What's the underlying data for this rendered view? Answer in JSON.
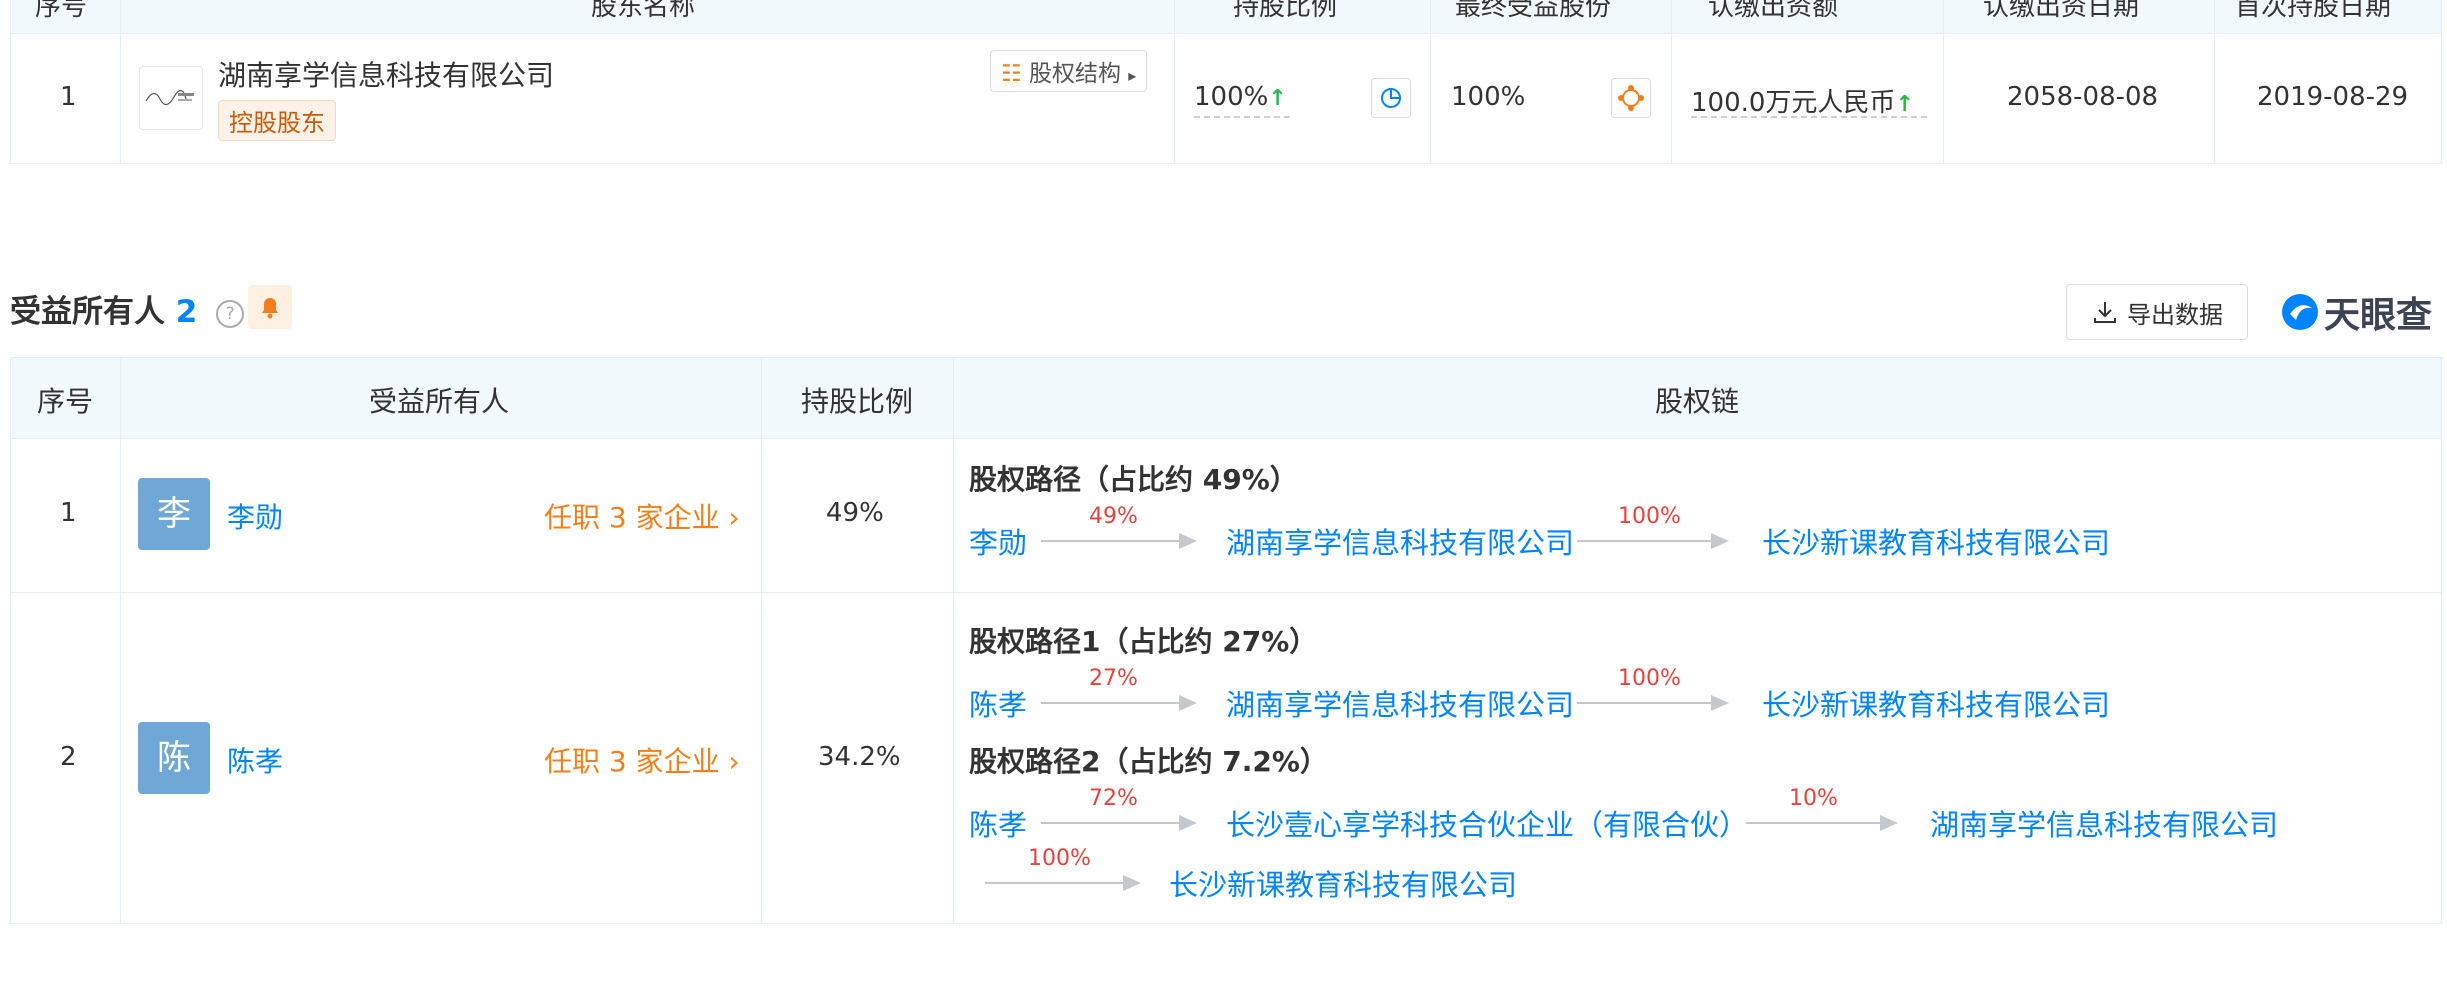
{
  "shareholder_table": {
    "headers": {
      "seq": "序号",
      "name": "股东名称",
      "ratio": "持股比例",
      "final_benefit": "最终受益股份",
      "capital": "认缴出资额",
      "capital_date": "认缴出资日期",
      "first_date": "首次持股日期"
    },
    "row": {
      "seq": "1",
      "company": "湖南享学信息科技有限公司",
      "badge": "控股股东",
      "structure_btn": "股权结构",
      "ratio": "100%",
      "final_benefit": "100%",
      "capital": "100.0万元人民币",
      "capital_date": "2058-08-08",
      "first_date": "2019-08-29"
    }
  },
  "beneficiary_section": {
    "title": "受益所有人",
    "count": "2",
    "export_label": "导出数据",
    "logo_text": "天眼查",
    "headers": {
      "seq": "序号",
      "owner": "受益所有人",
      "ratio": "持股比例",
      "chain": "股权链"
    },
    "rows": [
      {
        "seq": "1",
        "avatar": "李",
        "name": "李勋",
        "jobs": "任职 3 家企业",
        "ratio": "49%",
        "paths": [
          {
            "title": "股权路径（占比约 49%）",
            "nodes": [
              "李勋",
              "湖南享学信息科技有限公司",
              "长沙新课教育科技有限公司"
            ],
            "pcts": [
              "49%",
              "100%"
            ]
          }
        ]
      },
      {
        "seq": "2",
        "avatar": "陈",
        "name": "陈孝",
        "jobs": "任职 3 家企业",
        "ratio": "34.2%",
        "paths": [
          {
            "title": "股权路径1（占比约 27%）",
            "nodes": [
              "陈孝",
              "湖南享学信息科技有限公司",
              "长沙新课教育科技有限公司"
            ],
            "pcts": [
              "27%",
              "100%"
            ]
          },
          {
            "title": "股权路径2（占比约 7.2%）",
            "nodes": [
              "陈孝",
              "长沙壹心享学科技合伙企业（有限合伙）",
              "湖南享学信息科技有限公司",
              "长沙新课教育科技有限公司"
            ],
            "pcts": [
              "72%",
              "10%",
              "100%"
            ]
          }
        ]
      }
    ]
  }
}
